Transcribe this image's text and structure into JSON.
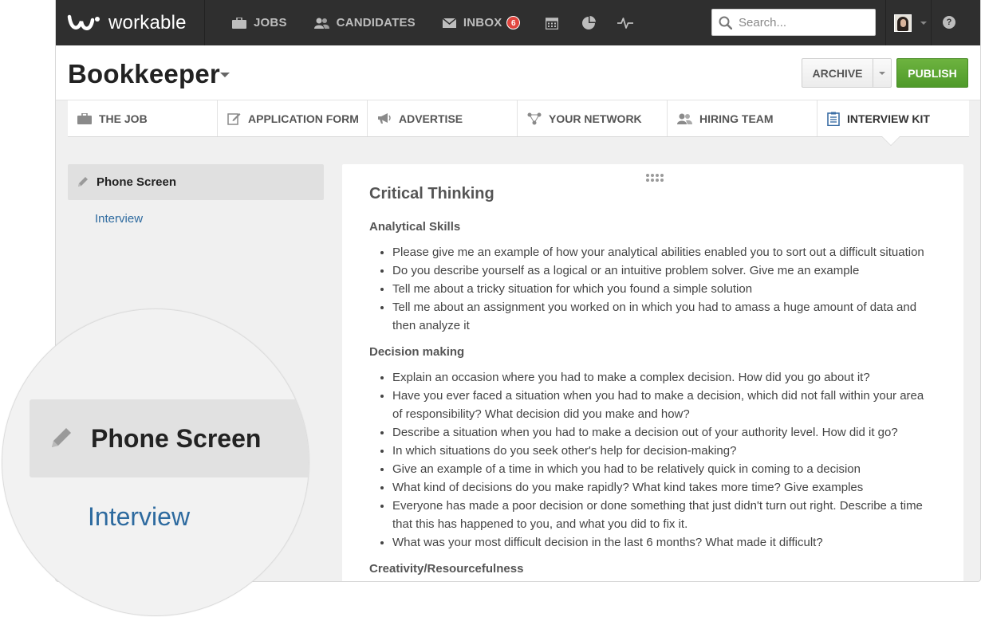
{
  "app": {
    "brand": "workable",
    "nav": [
      {
        "label": "JOBS",
        "icon": "briefcase-icon"
      },
      {
        "label": "CANDIDATES",
        "icon": "people-icon"
      },
      {
        "label": "INBOX",
        "icon": "envelope-icon",
        "badge": "6"
      }
    ],
    "nav_icons": [
      "calendar-icon",
      "pie-chart-icon",
      "activity-icon"
    ],
    "search_placeholder": "Search...",
    "colors": {
      "topbar": "#2f2f2f",
      "publish": "#5aa832",
      "link": "#2d6a9f",
      "badge": "#e0463f"
    }
  },
  "header": {
    "job_title": "Bookkeeper",
    "archive_label": "ARCHIVE",
    "publish_label": "PUBLISH"
  },
  "tabs": [
    {
      "label": "THE JOB",
      "icon": "briefcase-icon"
    },
    {
      "label": "APPLICATION FORM",
      "icon": "edit-icon"
    },
    {
      "label": "ADVERTISE",
      "icon": "megaphone-icon"
    },
    {
      "label": "YOUR NETWORK",
      "icon": "network-icon"
    },
    {
      "label": "HIRING TEAM",
      "icon": "team-icon"
    },
    {
      "label": "INTERVIEW KIT",
      "icon": "clipboard-icon",
      "active": true
    }
  ],
  "sidebar": {
    "active_item": "Phone Screen",
    "link_item": "Interview"
  },
  "panel": {
    "title": "Critical Thinking",
    "sections": [
      {
        "heading": "Analytical Skills",
        "items": [
          "Please give me an example of how your analytical abilities enabled you to sort out a difficult situation",
          "Do you describe yourself as a logical or an intuitive problem solver. Give me an example",
          "Tell me about a tricky situation for which you found a simple solution",
          "Tell me about an assignment you worked on in which you had to amass a huge amount of data and then analyze it"
        ]
      },
      {
        "heading": "Decision making",
        "items": [
          "Explain an occasion where you had to make a complex decision. How did you go about it?",
          "Have you ever faced a situation when you had to make a decision, which did not fall within your area of responsibility? What decision did you make and how?",
          "Describe a situation when you had to make a decision out of your authority level. How did it go?",
          "In which situations do you seek other's help for decision-making?",
          "Give an example of a time in which you had to be relatively quick in coming to a decision",
          "What kind of decisions do you make rapidly? What kind takes more time? Give examples",
          "Everyone has made a poor decision or done something that just didn't turn out right. Describe a time that this has happened to you, and what you did to fix it.",
          "What was your most difficult decision in the last 6 months? What made it difficult?"
        ]
      },
      {
        "heading": "Creativity/Resourcefulness",
        "items": []
      }
    ]
  },
  "magnifier": {
    "active_item": "Phone Screen",
    "link_item": "Interview"
  }
}
